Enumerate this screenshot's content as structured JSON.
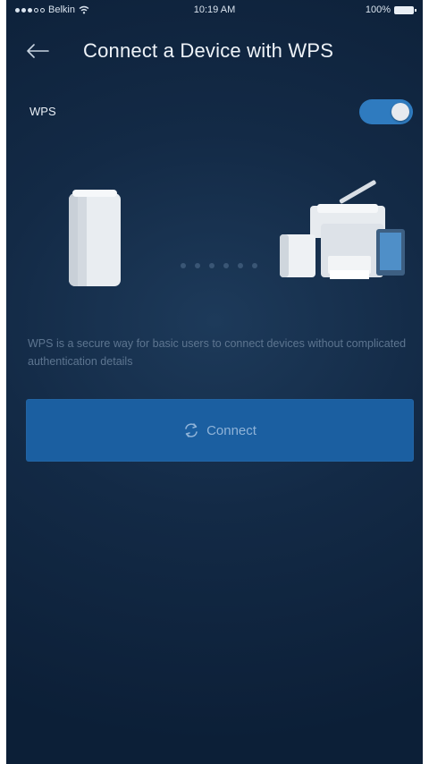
{
  "status_bar": {
    "carrier": "Belkin",
    "time": "10:19 AM",
    "battery": "100%"
  },
  "header": {
    "title": "Connect a Device with WPS"
  },
  "wps": {
    "label": "WPS",
    "enabled": true
  },
  "description": "WPS is a secure way for basic users to connect devices without complicated authentication details",
  "connect_button": {
    "label": "Connect",
    "icon": "wps-icon"
  },
  "colors": {
    "background": "#132a46",
    "accent": "#2f7bbf",
    "button": "#1b5fa1"
  }
}
